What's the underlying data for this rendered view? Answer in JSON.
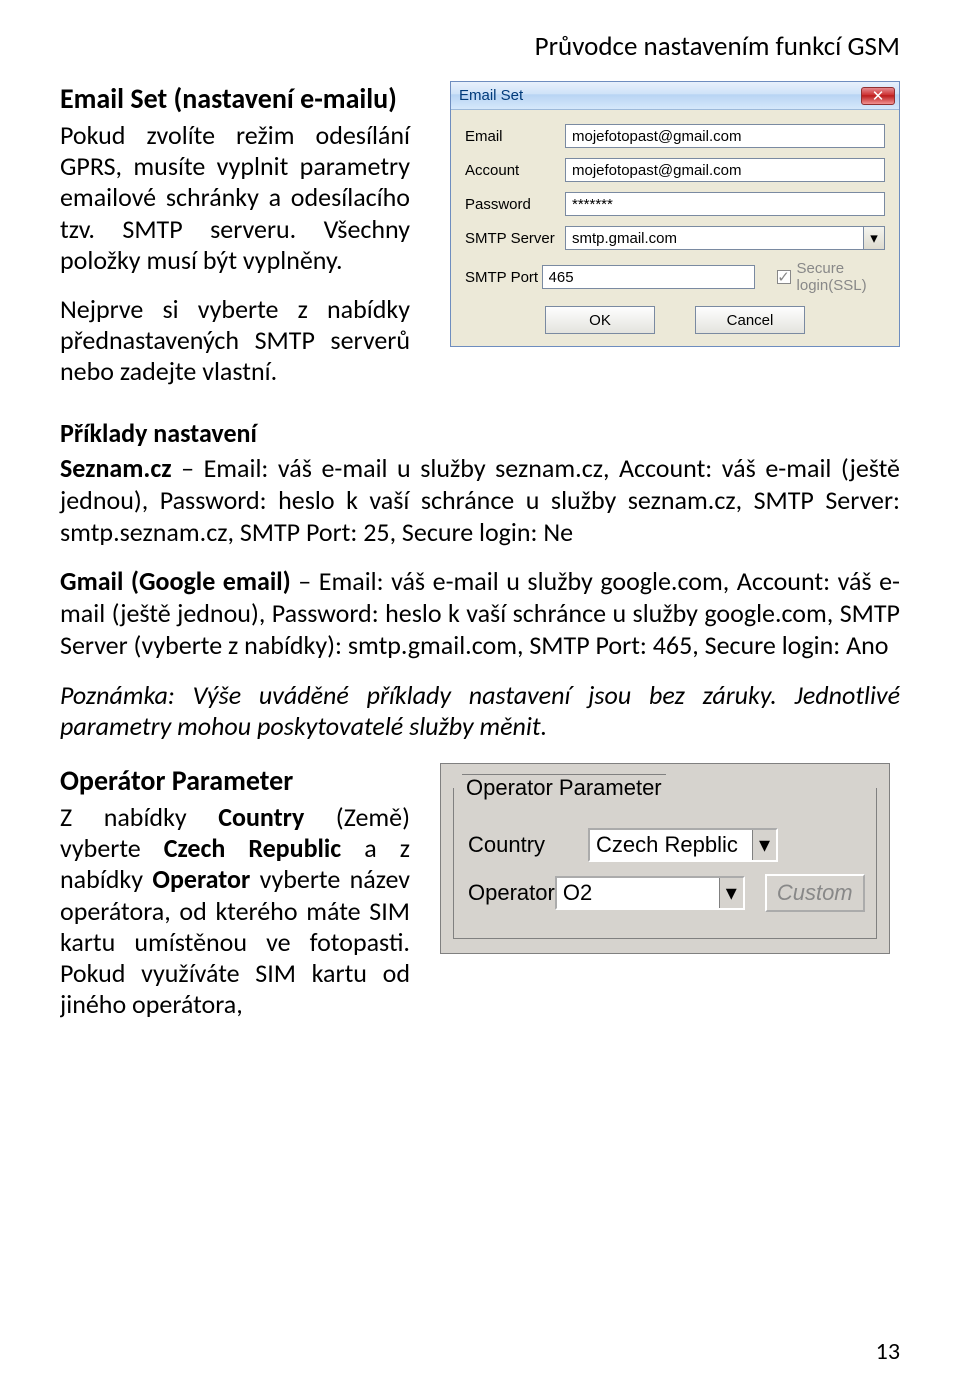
{
  "doc_header": "Průvodce nastavením funkcí GSM",
  "email_set": {
    "title": "Email Set (nastavení e-mailu)",
    "para1": "Pokud zvolíte režim odesílání GPRS, musíte vyplnit parametry emailové schránky a odesílacího tzv. SMTP serveru. Všechny položky musí být vyplněny.",
    "para2": "Nejprve si vyberte z nabídky přednastave­ných SMTP serverů nebo zadejte vlastní."
  },
  "examples": {
    "heading": "Příklady nastavení",
    "seznam_label": "Seznam.cz",
    "seznam_body": " – Email: váš e-mail u služby seznam.cz, Account: váš e-mail (ještě jednou), Password: heslo k vaší schránce u služby seznam.cz, SMTP Server: smtp.seznam.cz, SMTP Port: 25, Secure login: Ne",
    "gmail_label": "Gmail (Google email)",
    "gmail_body": " – Email: váš e-mail u služby google.com, Account: váš e-mail (ještě jednou), Password: heslo k vaší schránce u služby google.com, SMTP Server (vyberte z nabídky): smtp.gmail.com, SMTP Port: 465, Secure login: Ano",
    "note": "Poznámka: Výše uváděné příklady nastavení jsou bez záruky. Jednotlivé parametry mohou poskytovatelé služby měnit."
  },
  "operator_section": {
    "title": "Operátor Parameter",
    "body_pre": "Z nabídky ",
    "country_b": "Country",
    "body_mid1": " (Země) vyberte ",
    "czech_b": "Czech Republic",
    "body_mid2": " a z nabídky ",
    "operator_b": "Operator",
    "body_tail": " vyberte název operátora, od kterého máte SIM kartu umístěnou ve fotopasti. Pokud využíváte SIM kartu od jiného operátora, "
  },
  "dialog": {
    "title": "Email Set",
    "labels": {
      "email": "Email",
      "account": "Account",
      "password": "Password",
      "server": "SMTP Server",
      "port": "SMTP Port"
    },
    "values": {
      "email": "mojefotopast@gmail.com",
      "account": "mojefotopast@gmail.com",
      "password": "*******",
      "server": "smtp.gmail.com",
      "port": "465"
    },
    "secure_label": "Secure login(SSL)",
    "ok": "OK",
    "cancel": "Cancel"
  },
  "op_panel": {
    "legend": "Operator Parameter",
    "country_label": "Country",
    "country_value": "Czech Repblic",
    "operator_label": "Operator",
    "operator_value": "O2",
    "custom": "Custom"
  },
  "page": "13"
}
